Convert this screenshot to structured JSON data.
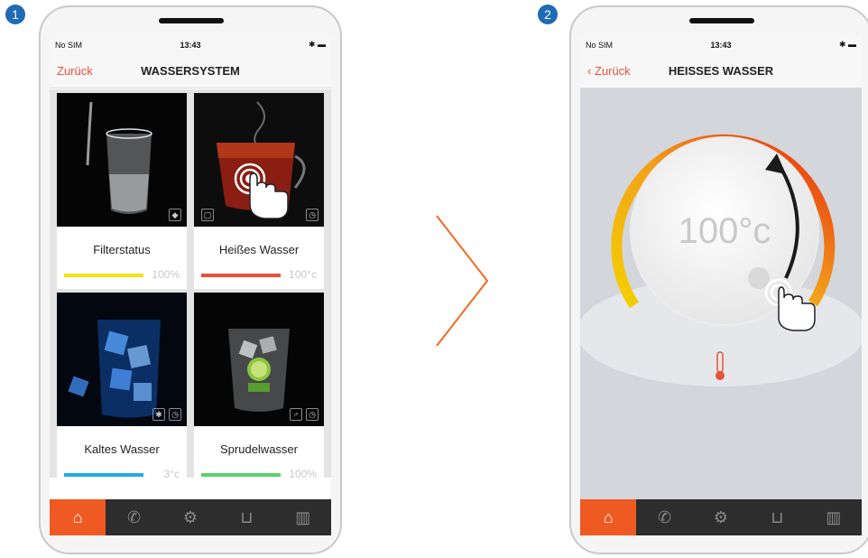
{
  "step_badges": [
    "1",
    "2"
  ],
  "left_phone": {
    "status": {
      "carrier": "No SIM",
      "time": "13:43"
    },
    "nav": {
      "back_label": "Zurück",
      "title": "WASSERSYSTEM"
    },
    "cards": [
      {
        "label": "Filterstatus",
        "value": "100%",
        "bar_color": "#f2e21a",
        "image": "glass-of-water",
        "icons": [
          "water-drop-icon"
        ]
      },
      {
        "label": "Heißes Wasser",
        "value": "100°c",
        "bar_color": "#e8503a",
        "image": "hot-tea-cup",
        "icons": [
          "lock-icon",
          "alarm-clock-icon"
        ]
      },
      {
        "label": "Kaltes Wasser",
        "value": "3°c",
        "bar_color": "#27aae1",
        "image": "ice-cubes-glass",
        "icons": [
          "snowflake-icon",
          "alarm-clock-icon"
        ]
      },
      {
        "label": "Sprudelwasser",
        "value": "100%",
        "bar_color": "#5bd16a",
        "image": "sparkling-water-lime",
        "icons": [
          "bubbles-icon",
          "alarm-clock-icon"
        ]
      }
    ]
  },
  "right_phone": {
    "status": {
      "carrier": "No SIM",
      "time": "13:43"
    },
    "nav": {
      "back_label": "Zurück",
      "title": "HEISSES WASSER"
    },
    "dial": {
      "temperature": "100°c"
    }
  },
  "tabs": [
    "home-icon",
    "phone-service-icon",
    "settings-gear-icon",
    "shopping-cart-icon",
    "bar-chart-icon"
  ],
  "colors": {
    "accent": "#ef5a22",
    "back_link": "#e8503a",
    "tabbar": "#2d2d2d",
    "badge": "#1f6bb5"
  }
}
